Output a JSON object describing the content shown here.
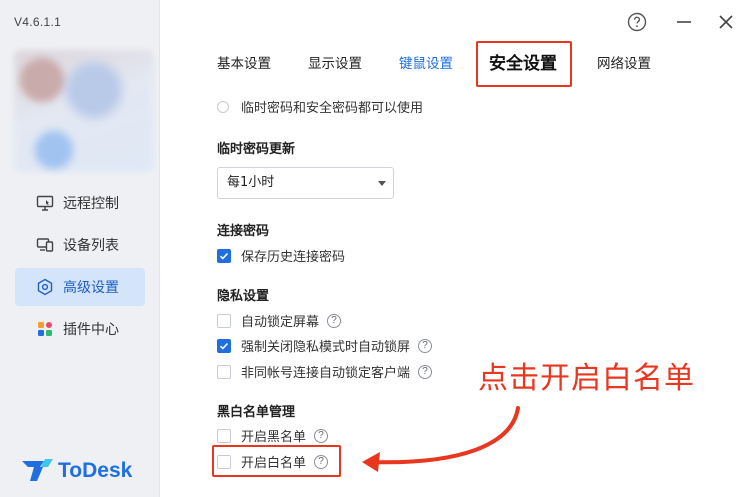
{
  "app": {
    "version": "V4.6.1.1",
    "logo_text": "ToDesk"
  },
  "sidebar": {
    "items": [
      {
        "label": "远程控制",
        "icon": "remote-control-icon",
        "active": false
      },
      {
        "label": "设备列表",
        "icon": "device-list-icon",
        "active": false
      },
      {
        "label": "高级设置",
        "icon": "advanced-settings-icon",
        "active": true
      },
      {
        "label": "插件中心",
        "icon": "plugin-center-icon",
        "active": false
      }
    ]
  },
  "window": {
    "help_icon": "help-icon",
    "minimize_icon": "minimize-icon",
    "close_icon": "close-icon"
  },
  "tabs": [
    {
      "label": "基本设置"
    },
    {
      "label": "显示设置"
    },
    {
      "label": "键鼠设置"
    },
    {
      "label": "安全设置"
    },
    {
      "label": "网络设置"
    }
  ],
  "security": {
    "radio_option": "临时密码和安全密码都可以使用",
    "temp_password_heading": "临时密码更新",
    "temp_password_select": "每1小时",
    "connection_password_heading": "连接密码",
    "save_history_password": "保存历史连接密码",
    "privacy_heading": "隐私设置",
    "auto_lock_screen": "自动锁定屏幕",
    "force_close_privacy_lock": "强制关闭隐私模式时自动锁屏",
    "non_same_account_lock": "非同帐号连接自动锁定客户端",
    "blackwhite_heading": "黑白名单管理",
    "enable_blacklist": "开启黑名单",
    "enable_whitelist": "开启白名单",
    "help_glyph": "?"
  },
  "annotation": {
    "text": "点击开启白名单",
    "color": "#e9361e"
  },
  "colors": {
    "accent": "#1f6fe0",
    "sidebar_bg": "#eef0f4",
    "active_nav_bg": "#d4e4fb"
  }
}
